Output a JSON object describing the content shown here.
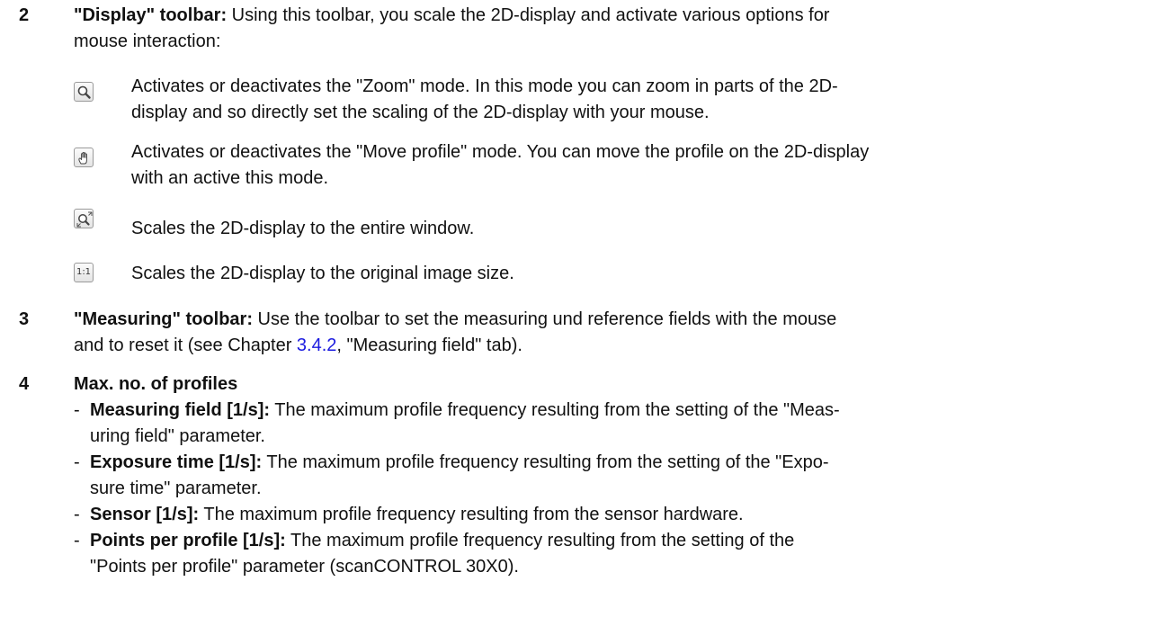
{
  "section_2": {
    "number": "2",
    "title": "\"Display\" toolbar:",
    "text_line1": " Using this toolbar, you scale the 2D-display and activate various options for",
    "text_line2": "mouse interaction:",
    "items": [
      {
        "icon": "zoom-icon",
        "line1": "Activates or deactivates the \"Zoom\" mode. In this mode you can zoom in parts of the 2D-",
        "line2": "display and so directly set the scaling of the 2D-display with your mouse."
      },
      {
        "icon": "hand-icon",
        "line1": "Activates or deactivates the \"Move profile\" mode. You can move the profile on the 2D-display",
        "line2": "with an active this mode."
      },
      {
        "icon": "fit-window-icon",
        "line1": "Scales the 2D-display to the entire window."
      },
      {
        "icon": "original-size-icon",
        "icon_label": "1:1",
        "line1": "Scales the 2D-display to the original image size."
      }
    ]
  },
  "section_3": {
    "number": "3",
    "title": "\"Measuring\" toolbar:",
    "text_line1": " Use the toolbar to set the measuring und reference fields with the mouse",
    "text_line2_prefix": "and to reset it (see Chapter ",
    "link_text": "3.4.2",
    "text_line2_suffix": ", \"Measuring field\" tab)."
  },
  "section_4": {
    "number": "4",
    "title": "Max. no. of profiles",
    "dash": "-",
    "bullets": [
      {
        "label": "Measuring field [1/s]:",
        "line1": " The maximum profile frequency resulting from the setting of the \"Meas-",
        "line2": "uring field\" parameter."
      },
      {
        "label": "Exposure time [1/s]:",
        "line1": " The maximum profile frequency resulting from the setting of the \"Expo-",
        "line2": "sure time\" parameter."
      },
      {
        "label": "Sensor [1/s]:",
        "line1": " The maximum profile frequency resulting from the sensor hardware."
      },
      {
        "label": "Points per profile [1/s]:",
        "line1": " The maximum profile frequency resulting from the setting of the",
        "line2": "\"Points per profile\" parameter (scanCONTROL 30X0)."
      }
    ]
  }
}
